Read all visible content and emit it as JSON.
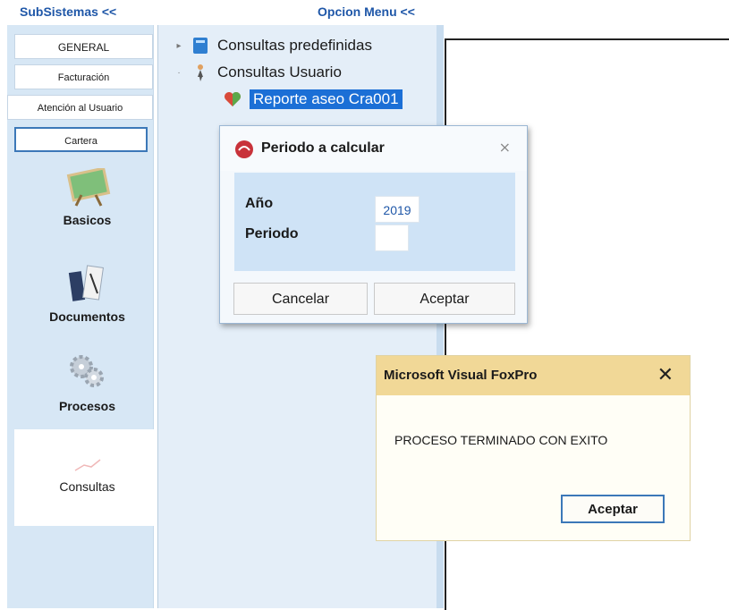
{
  "subsystems": {
    "header": "SubSistemas <<",
    "tabs": [
      "GENERAL",
      "Facturación",
      "Atención al Usuario",
      "Cartera"
    ],
    "tools": {
      "basicos": "Basicos",
      "documentos": "Documentos",
      "procesos": "Procesos",
      "consultas": "Consultas"
    }
  },
  "option_menu": {
    "header": "Opcion Menu <<",
    "items": {
      "predefinidas": "Consultas predefinidas",
      "usuario": "Consultas Usuario",
      "reporte": "Reporte aseo Cra001"
    }
  },
  "periodo_dialog": {
    "title": "Periodo a calcular",
    "anio_label": "Año",
    "periodo_label": "Periodo",
    "anio_value": "2019",
    "periodo_value": "",
    "cancel": "Cancelar",
    "accept": "Aceptar"
  },
  "message_box": {
    "title": "Microsoft Visual FoxPro",
    "message": "PROCESO TERMINADO CON EXITO",
    "ok": "Aceptar"
  },
  "colors": {
    "accent": "#1f57a8",
    "panel": "#d7e7f5",
    "selection": "#1b6fd6",
    "message_titlebar": "#f1d897"
  },
  "icons": [
    "book-icon",
    "user-icon",
    "heart-icon",
    "whiteboard-icon",
    "document-icon",
    "gears-icon",
    "chart-icon",
    "app-icon",
    "close-icon"
  ]
}
